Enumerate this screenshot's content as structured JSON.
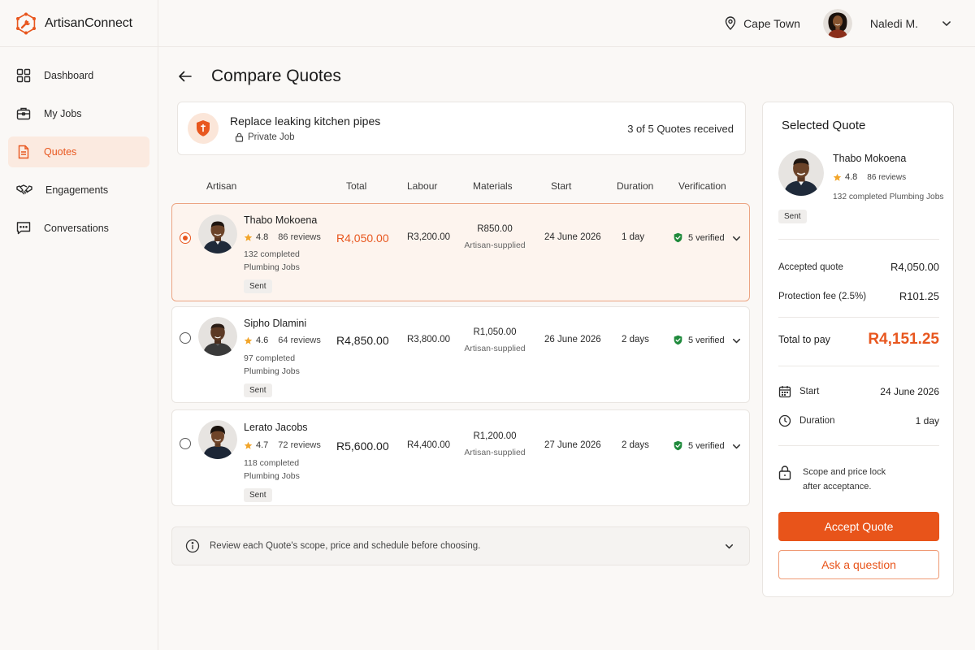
{
  "app": {
    "name": "ArtisanConnect"
  },
  "topbar": {
    "location": "Cape Town",
    "user_name": "Naledi M."
  },
  "sidebar": {
    "items": [
      {
        "label": "Dashboard",
        "icon": "grid-icon"
      },
      {
        "label": "My Jobs",
        "icon": "briefcase-icon"
      },
      {
        "label": "Quotes",
        "icon": "document-icon",
        "active": true
      },
      {
        "label": "Engagements",
        "icon": "handshake-icon"
      },
      {
        "label": "Conversations",
        "icon": "chat-icon"
      }
    ]
  },
  "page": {
    "title": "Compare Quotes"
  },
  "job": {
    "title": "Replace leaking kitchen pipes",
    "visibility": "Private Job",
    "quotes_count": "3 of 5 Quotes received"
  },
  "table": {
    "headers": [
      "Artisan",
      "Total",
      "Labour",
      "Materials",
      "Start",
      "Duration",
      "Verification"
    ]
  },
  "quotes": [
    {
      "name": "Thabo Mokoena",
      "rating": "4.8",
      "reviews": "86 reviews",
      "jobs": "132 completed Plumbing Jobs",
      "status": "Sent",
      "total": "R4,050.00",
      "labour": "R3,200.00",
      "materials": "R850.00",
      "materials_note": "Artisan-supplied",
      "start": "24 June 2026",
      "duration": "1 day",
      "verification": "5 verified",
      "selected": true
    },
    {
      "name": "Sipho Dlamini",
      "rating": "4.6",
      "reviews": "64 reviews",
      "jobs": "97 completed Plumbing Jobs",
      "status": "Sent",
      "total": "R4,850.00",
      "labour": "R3,800.00",
      "materials": "R1,050.00",
      "materials_note": "Artisan-supplied",
      "start": "26 June 2026",
      "duration": "2 days",
      "verification": "5 verified",
      "selected": false
    },
    {
      "name": "Lerato Jacobs",
      "rating": "4.7",
      "reviews": "72 reviews",
      "jobs": "118 completed Plumbing Jobs",
      "status": "Sent",
      "total": "R5,600.00",
      "labour": "R4,400.00",
      "materials": "R1,200.00",
      "materials_note": "Artisan-supplied",
      "start": "27 June 2026",
      "duration": "2 days",
      "verification": "5 verified",
      "selected": false
    }
  ],
  "info": {
    "text": "Review each Quote's scope, price and schedule before choosing."
  },
  "panel": {
    "title": "Selected Quote",
    "name": "Thabo Mokoena",
    "rating": "4.8",
    "reviews": "86 reviews",
    "jobs": "132 completed Plumbing Jobs",
    "status": "Sent",
    "accepted_label": "Accepted quote",
    "accepted_value": "R4,050.00",
    "fee_label": "Protection fee (2.5%)",
    "fee_value": "R101.25",
    "total_label": "Total to pay",
    "total_value": "R4,151.25",
    "start_label": "Start",
    "start_value": "24 June 2026",
    "duration_label": "Duration",
    "duration_value": "1 day",
    "lock_note": [
      "Scope and price lock",
      "after acceptance."
    ],
    "accept_button": "Accept Quote",
    "ask_button": "Ask a question"
  },
  "colors": {
    "accent": "#e8571f",
    "verified": "#1f8a3c",
    "star": "#f2a52a"
  }
}
